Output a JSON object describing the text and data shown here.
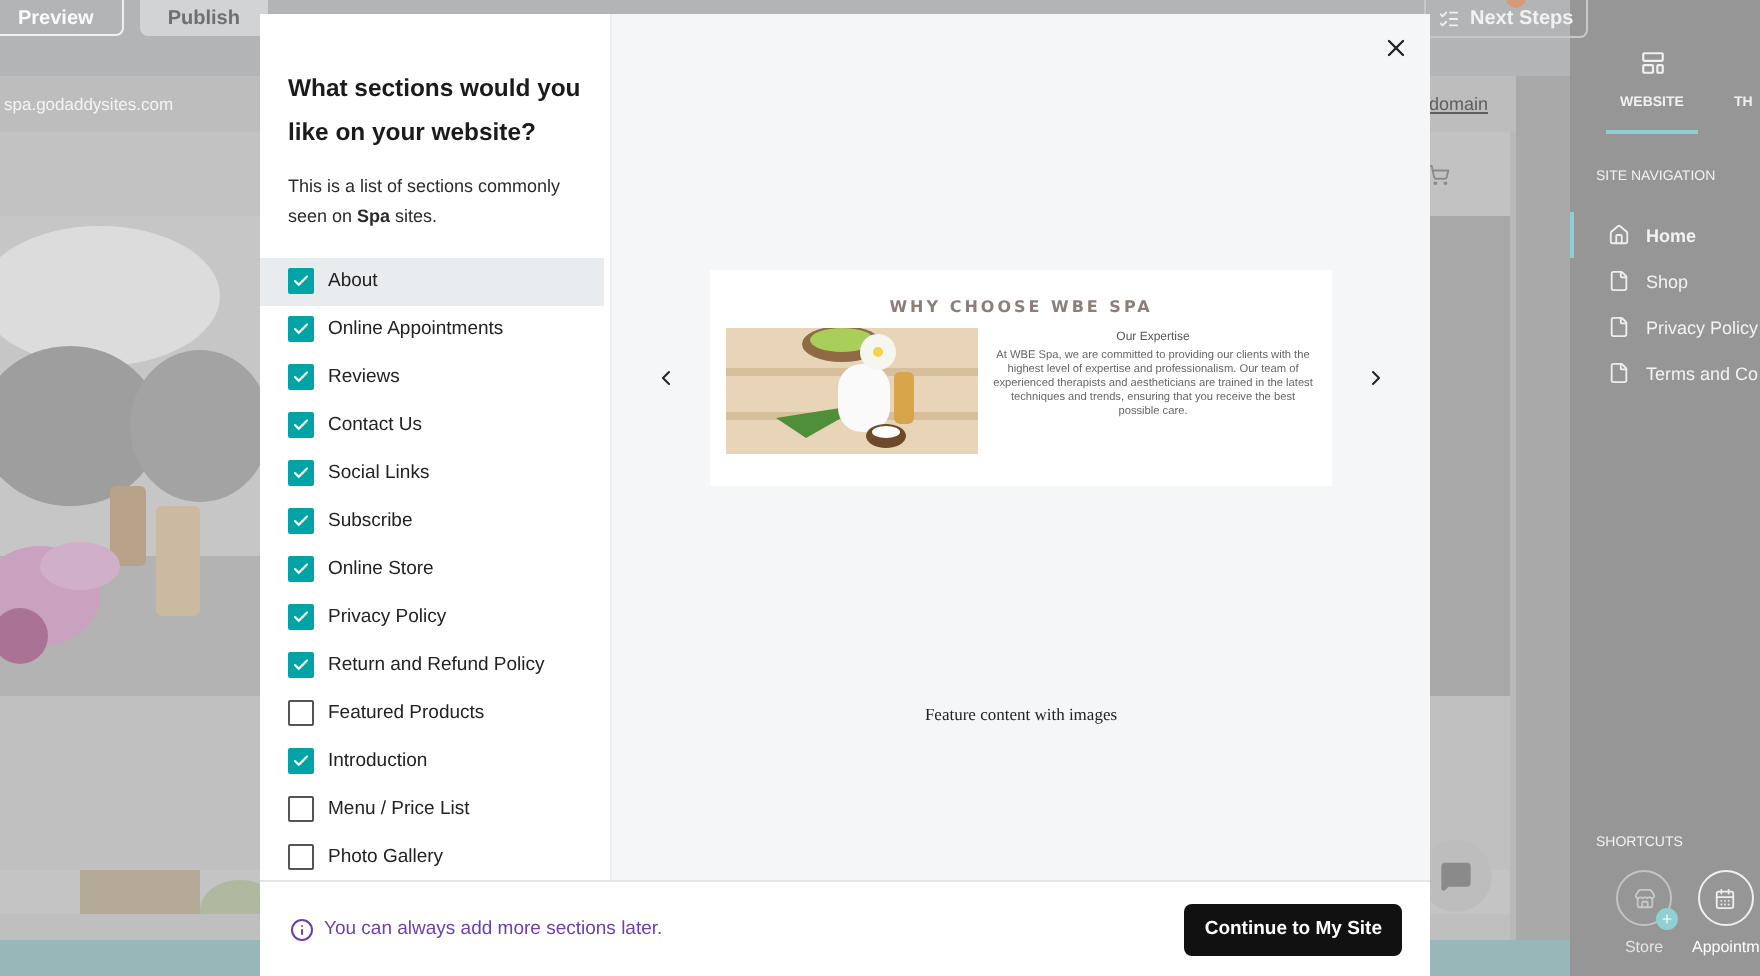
{
  "editor": {
    "buttons": [
      {
        "label": "Preview",
        "kind": "outline"
      },
      {
        "label": "Publish",
        "kind": "plain"
      }
    ],
    "next_steps": "Next Steps",
    "address": "spa.godaddysites.com",
    "domain_link": "domain"
  },
  "sidebar": {
    "tabs": [
      {
        "label": "WEBSITE",
        "selected": true
      },
      {
        "label": "TH",
        "selected": false
      }
    ],
    "nav_heading": "SITE NAVIGATION",
    "nav_items": [
      {
        "label": "Home",
        "kind": "home",
        "selected": true
      },
      {
        "label": "Shop",
        "kind": "page",
        "selected": false
      },
      {
        "label": "Privacy Policy",
        "kind": "page",
        "selected": false
      },
      {
        "label": "Terms and Co",
        "kind": "page",
        "selected": false
      }
    ],
    "shortcuts_heading": "SHORTCUTS",
    "shortcuts": [
      {
        "label": "Store",
        "kind": "store"
      },
      {
        "label": "Appointm",
        "kind": "calendar"
      }
    ]
  },
  "modal": {
    "title": "What sections would you like on your website?",
    "intro": "This is a list of sections commonly seen on **Spa** sites.",
    "sections": [
      {
        "label": "About",
        "checked": true,
        "highlighted": true
      },
      {
        "label": "Online Appointments",
        "checked": true,
        "highlighted": false
      },
      {
        "label": "Reviews",
        "checked": true,
        "highlighted": false
      },
      {
        "label": "Contact Us",
        "checked": true,
        "highlighted": false
      },
      {
        "label": "Social Links",
        "checked": true,
        "highlighted": false
      },
      {
        "label": "Subscribe",
        "checked": true,
        "highlighted": false
      },
      {
        "label": "Online Store",
        "checked": true,
        "highlighted": false
      },
      {
        "label": "Privacy Policy",
        "checked": true,
        "highlighted": false
      },
      {
        "label": "Return and Refund Policy",
        "checked": true,
        "highlighted": false
      },
      {
        "label": "Featured Products",
        "checked": false,
        "highlighted": false
      },
      {
        "label": "Introduction",
        "checked": true,
        "highlighted": false
      },
      {
        "label": "Menu / Price List",
        "checked": false,
        "highlighted": false
      },
      {
        "label": "Photo Gallery",
        "checked": false,
        "highlighted": false
      }
    ],
    "preview": {
      "heading": "WHY CHOOSE WBE SPA",
      "subheading": "Our Expertise",
      "body": "At WBE Spa, we are committed to providing our clients with the highest level of expertise and professionalism. Our team of experienced therapists and aestheticians are trained in the latest techniques and trends, ensuring that you receive the best possible care.",
      "caption": "Feature content with images"
    },
    "note": "You can always add more sections later.",
    "continue_button": "Continue to My Site"
  }
}
